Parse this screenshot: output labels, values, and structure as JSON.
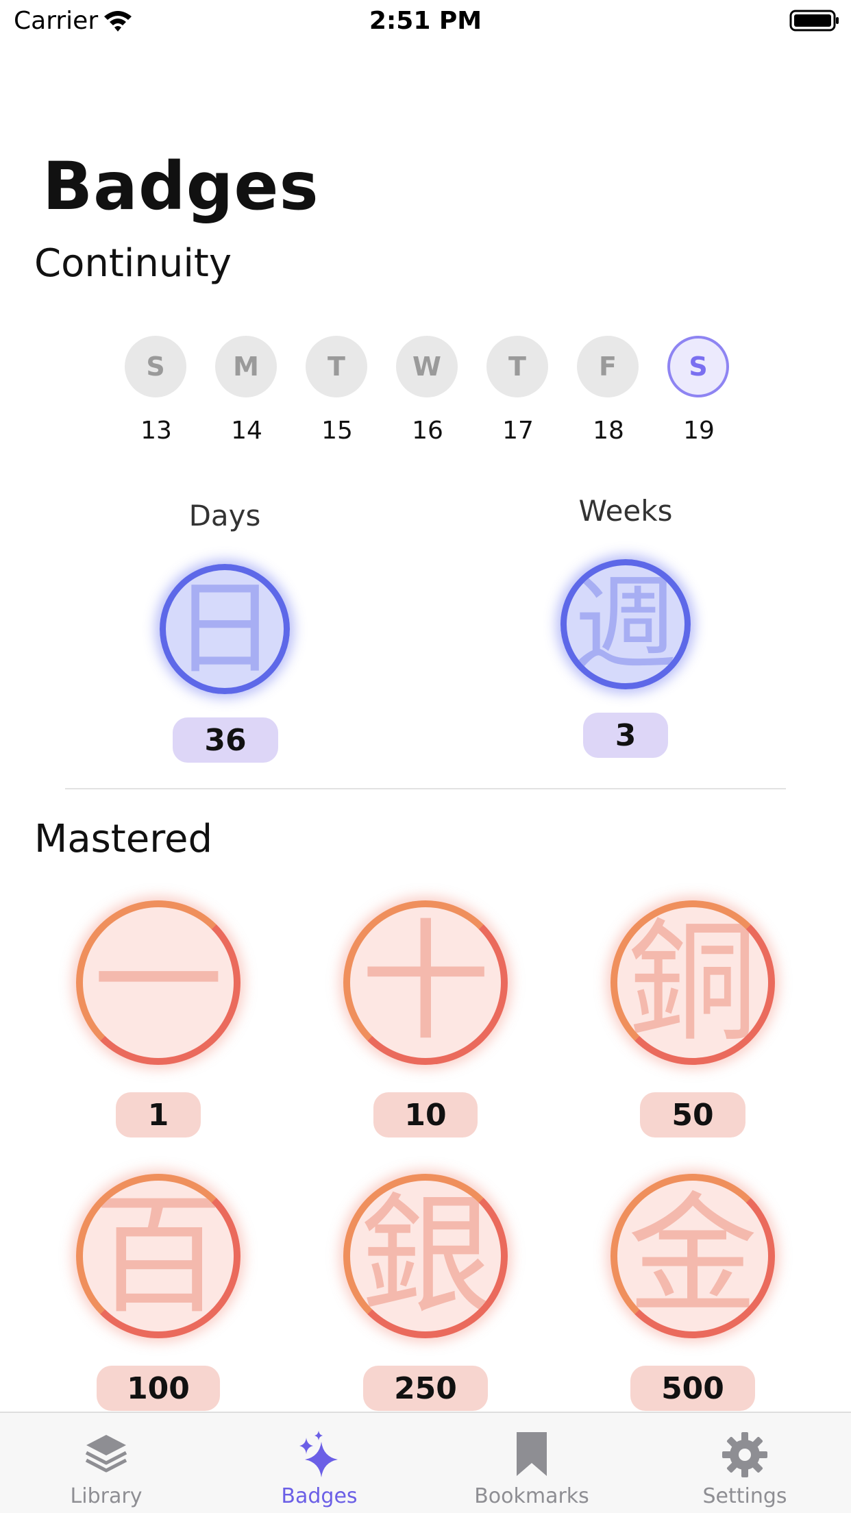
{
  "status_bar": {
    "carrier": "Carrier",
    "time": "2:51 PM"
  },
  "page": {
    "title": "Badges"
  },
  "continuity": {
    "title": "Continuity",
    "days": [
      {
        "letter": "S",
        "date": "13",
        "today": false
      },
      {
        "letter": "M",
        "date": "14",
        "today": false
      },
      {
        "letter": "T",
        "date": "15",
        "today": false
      },
      {
        "letter": "W",
        "date": "16",
        "today": false
      },
      {
        "letter": "T",
        "date": "17",
        "today": false
      },
      {
        "letter": "F",
        "date": "18",
        "today": false
      },
      {
        "letter": "S",
        "date": "19",
        "today": true
      }
    ],
    "days_badge": {
      "label": "Days",
      "kanji": "日",
      "count": "36"
    },
    "weeks_badge": {
      "label": "Weeks",
      "kanji": "週",
      "count": "3"
    }
  },
  "mastered": {
    "title": "Mastered",
    "badges": [
      {
        "kanji": "一",
        "count": "1"
      },
      {
        "kanji": "十",
        "count": "10"
      },
      {
        "kanji": "銅",
        "count": "50"
      },
      {
        "kanji": "百",
        "count": "100"
      },
      {
        "kanji": "銀",
        "count": "250"
      },
      {
        "kanji": "金",
        "count": "500"
      }
    ]
  },
  "tab_bar": {
    "items": [
      {
        "label": "Library",
        "icon": "layers-icon",
        "active": false
      },
      {
        "label": "Badges",
        "icon": "sparkles-icon",
        "active": true
      },
      {
        "label": "Bookmarks",
        "icon": "bookmark-icon",
        "active": false
      },
      {
        "label": "Settings",
        "icon": "gear-icon",
        "active": false
      }
    ]
  },
  "colors": {
    "accent": "#6b5fe6",
    "continuity_ring": "#5d68e8",
    "mastered_ring": "#ea6a5c"
  }
}
